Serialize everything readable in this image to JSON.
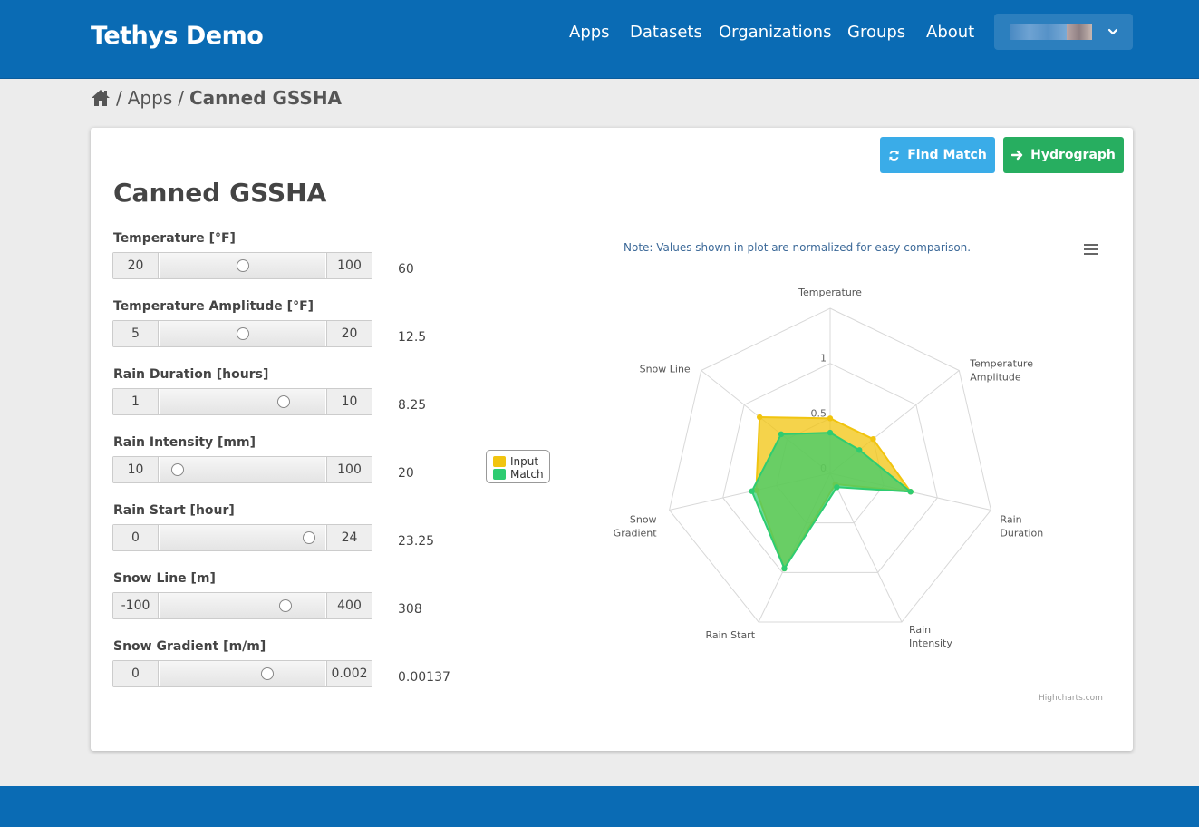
{
  "brand": "Tethys Demo",
  "nav": [
    "Apps",
    "Datasets",
    "Organizations",
    "Groups",
    "About"
  ],
  "breadcrumb": {
    "sep": "/",
    "apps": "Apps",
    "current": "Canned GSSHA"
  },
  "buttons": {
    "find_match": "Find Match",
    "hydrograph": "Hydrograph"
  },
  "page_title": "Canned GSSHA",
  "sliders": [
    {
      "label": "Temperature [°F]",
      "min": "20",
      "max": "100",
      "value": "60"
    },
    {
      "label": "Temperature Amplitude [°F]",
      "min": "5",
      "max": "20",
      "value": "12.5"
    },
    {
      "label": "Rain Duration [hours]",
      "min": "1",
      "max": "10",
      "value": "8.25"
    },
    {
      "label": "Rain Intensity [mm]",
      "min": "10",
      "max": "100",
      "value": "20"
    },
    {
      "label": "Rain Start [hour]",
      "min": "0",
      "max": "24",
      "value": "23.25"
    },
    {
      "label": "Snow Line [m]",
      "min": "-100",
      "max": "400",
      "value": "308"
    },
    {
      "label": "Snow Gradient [m/m]",
      "min": "0",
      "max": "0.002",
      "value": "0.00137"
    }
  ],
  "slider_fractions": [
    0.5,
    0.5,
    0.75,
    0.11,
    0.9,
    0.76,
    0.65
  ],
  "chart_note": "Note: Values shown in plot are normalized for easy comparison.",
  "credits": "Highcharts.com",
  "chart_data": {
    "type": "radar",
    "categories": [
      "Temperature",
      "Temperature Amplitude",
      "Rain Duration",
      "Rain Intensity",
      "Rain Start",
      "Snow Gradient",
      "Snow Line"
    ],
    "category_lines": [
      [
        "Temperature"
      ],
      [
        "Temperature",
        "Amplitude"
      ],
      [
        "Rain",
        "Duration"
      ],
      [
        "Rain",
        "Intensity"
      ],
      [
        "Rain Start"
      ],
      [
        "Snow",
        "Gradient"
      ],
      [
        "Snow Line"
      ]
    ],
    "radial_ticks": [
      "0",
      "0.5",
      "1"
    ],
    "ylim": [
      0,
      1.5
    ],
    "series": [
      {
        "name": "Input",
        "color": "#f1c40f",
        "values": [
          0.5,
          0.5,
          0.75,
          0.11,
          0.96,
          0.69,
          0.82
        ]
      },
      {
        "name": "Match",
        "color": "#2ecc71",
        "values": [
          0.37,
          0.34,
          0.75,
          0.14,
          0.96,
          0.73,
          0.57
        ]
      }
    ]
  },
  "colors": {
    "header": "#0a6bb4",
    "find_button": "#3aace8",
    "hydrograph_button": "#27ae60"
  }
}
